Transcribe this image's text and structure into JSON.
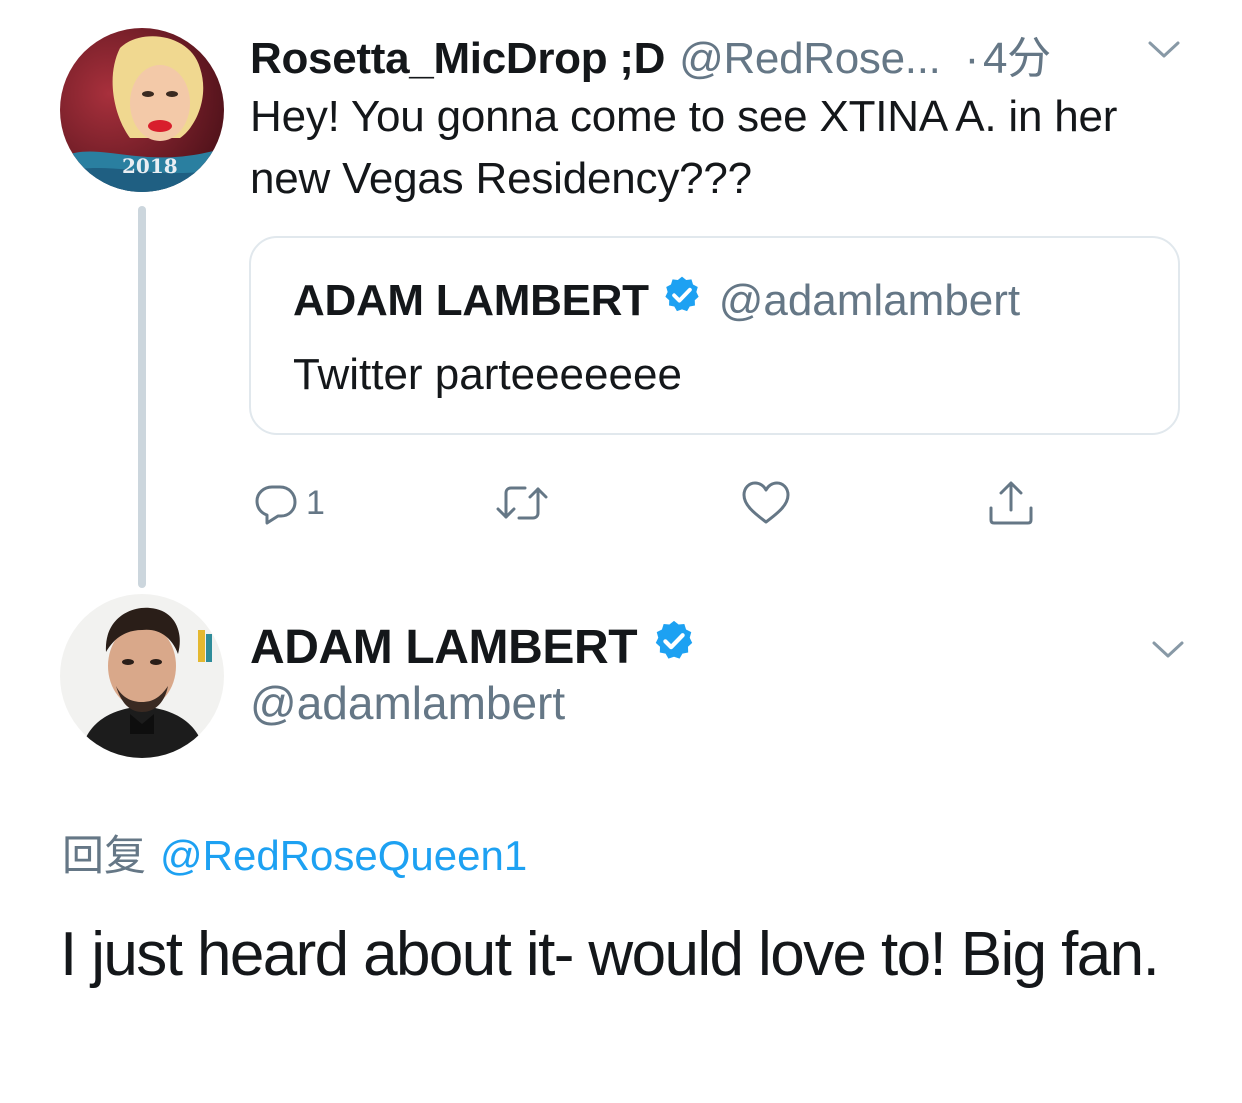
{
  "tweet1": {
    "display_name": "Rosetta_MicDrop ;D",
    "handle": "@RedRose...",
    "dot": "·",
    "time": "4分",
    "text": "Hey! You gonna come to see XTINA A. in her new Vegas Residency???",
    "avatar_badge": "2018"
  },
  "quoted": {
    "display_name": "ADAM LAMBERT",
    "handle": "@adamlambert",
    "text": "Twitter parteeeeeee"
  },
  "actions": {
    "reply_count": "1",
    "retweet_count": "",
    "like_count": ""
  },
  "tweet2": {
    "display_name": "ADAM LAMBERT",
    "handle": "@adamlambert",
    "reply_label": "回复",
    "reply_mention": "@RedRoseQueen1",
    "text": "I just heard about it- would love to! Big fan."
  },
  "colors": {
    "verified": "#1da1f2",
    "link": "#1da1f2",
    "muted": "#657786",
    "thread_line": "#ccd6dd"
  },
  "icons": [
    "reply-icon",
    "retweet-icon",
    "like-icon",
    "share-icon",
    "verified-badge-icon",
    "chevron-down-icon"
  ]
}
